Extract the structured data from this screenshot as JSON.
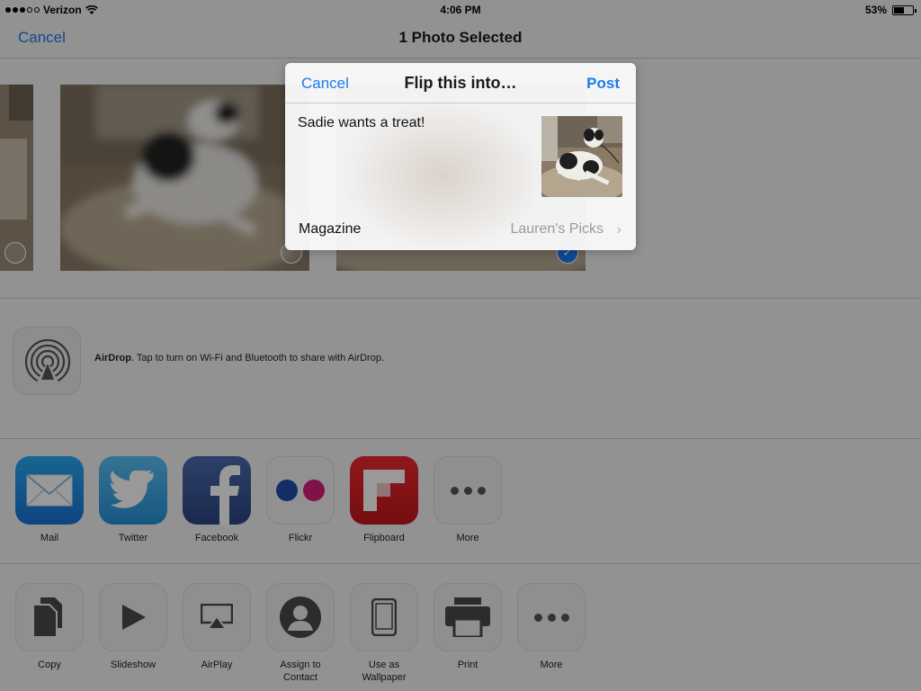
{
  "status_bar": {
    "carrier": "Verizon",
    "time": "4:06 PM",
    "battery": "53%",
    "icons": [
      "signal-dots-icon",
      "wifi-icon",
      "battery-icon"
    ]
  },
  "nav": {
    "cancel_label": "Cancel",
    "title": "1 Photo Selected"
  },
  "photos": [
    {
      "selected": false
    },
    {
      "selected": false
    },
    {
      "selected": true
    }
  ],
  "airdrop": {
    "icon": "airdrop-icon",
    "title": "AirDrop",
    "description": ". Tap to turn on Wi-Fi and Bluetooth to share with AirDrop."
  },
  "share_apps": [
    {
      "label": "Mail",
      "icon": "mail-icon"
    },
    {
      "label": "Twitter",
      "icon": "twitter-icon"
    },
    {
      "label": "Facebook",
      "icon": "facebook-icon"
    },
    {
      "label": "Flickr",
      "icon": "flickr-icon"
    },
    {
      "label": "Flipboard",
      "icon": "flipboard-icon"
    },
    {
      "label": "More",
      "icon": "more-icon"
    }
  ],
  "actions": [
    {
      "label": "Copy",
      "icon": "copy-icon"
    },
    {
      "label": "Slideshow",
      "icon": "play-icon"
    },
    {
      "label": "AirPlay",
      "icon": "airplay-icon"
    },
    {
      "label": "Assign to Contact",
      "icon": "contact-icon"
    },
    {
      "label": "Use as Wallpaper",
      "icon": "wallpaper-icon"
    },
    {
      "label": "Print",
      "icon": "printer-icon"
    },
    {
      "label": "More",
      "icon": "more-icon"
    }
  ],
  "composer": {
    "cancel_label": "Cancel",
    "title": "Flip this into…",
    "post_label": "Post",
    "text": "Sadie wants a treat!",
    "magazine_label": "Magazine",
    "magazine_value": "Lauren's Picks"
  },
  "colors": {
    "accent": "#1a7cf0",
    "dim_overlay": "rgba(0,0,0,0.40)"
  }
}
